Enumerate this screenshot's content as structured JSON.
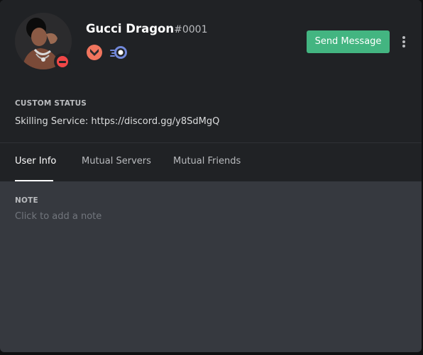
{
  "profile": {
    "username": "Gucci Dragon",
    "discriminator": "#0001",
    "status": "dnd",
    "badges": [
      "hypesquad-bravery-icon",
      "early-supporter-icon"
    ]
  },
  "actions": {
    "send_message_label": "Send Message"
  },
  "custom_status": {
    "label": "CUSTOM STATUS",
    "text": "Skilling Service: https://discord.gg/y8SdMgQ"
  },
  "tabs": [
    {
      "label": "User Info",
      "active": true
    },
    {
      "label": "Mutual Servers",
      "active": false
    },
    {
      "label": "Mutual Friends",
      "active": false
    }
  ],
  "note": {
    "label": "NOTE",
    "placeholder": "Click to add a note"
  },
  "colors": {
    "send_button": "#43b581",
    "dnd_status": "#f04747",
    "header_bg": "#202225",
    "body_bg": "#36393f"
  }
}
